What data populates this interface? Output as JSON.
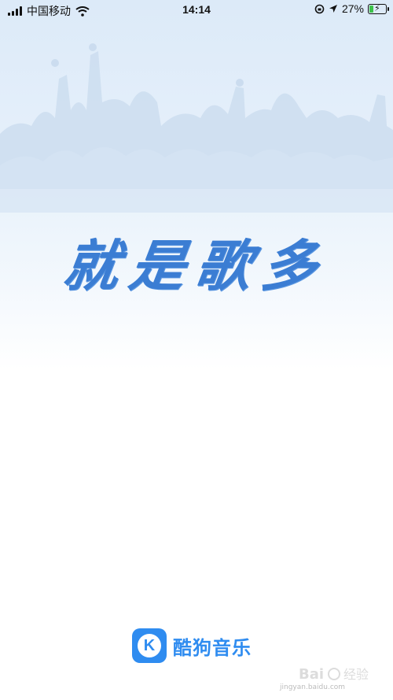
{
  "status_bar": {
    "carrier": "中国移动",
    "time": "14:14",
    "battery_percent": "27%",
    "battery_level": 0.27,
    "icons": [
      "signal-icon",
      "wifi-icon",
      "lock-rotation-icon",
      "location-arrow-icon",
      "battery-icon"
    ]
  },
  "splash": {
    "slogan": "就是歌多",
    "app_name": "酷狗音乐",
    "logo_letter": "K",
    "brand_color": "#2f8cf0",
    "slogan_color": "#3b7dd3"
  },
  "watermark": {
    "text": "jingyan.baidu.com"
  }
}
